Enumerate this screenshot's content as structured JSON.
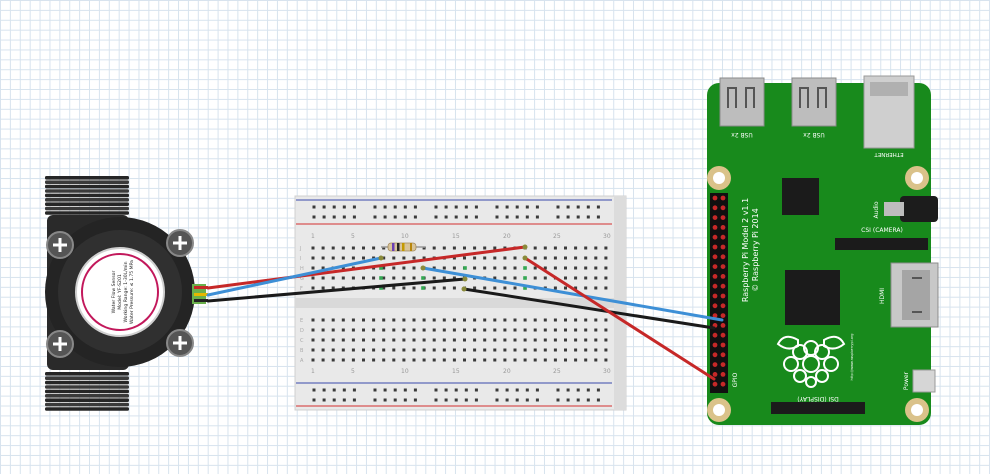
{
  "canvas": {
    "width": 990,
    "height": 474,
    "grid": true
  },
  "sensor": {
    "label_lines": [
      "Water Flow Sensor",
      "Model: YF-S201",
      "Working Range: 1-30L/min",
      "Water Pressure: ≤ 1.75 MPa"
    ],
    "body_color": "#2f2f2f",
    "dial_color": "#ffffff",
    "ring_color": "#c2185b",
    "screw_icon": "phillips-screw-icon"
  },
  "breadboard": {
    "rail_positive_color": "#d32f2f",
    "rail_negative_color": "#3949ab",
    "column_numbers": [
      "1",
      "5",
      "10",
      "15",
      "20",
      "25",
      "30"
    ],
    "row_letters_top": [
      "J",
      "I",
      "H",
      "G",
      "F"
    ],
    "row_letters_bottom": [
      "E",
      "D",
      "C",
      "B",
      "A"
    ],
    "resistor_icon": "resistor-icon"
  },
  "pi": {
    "board_color": "#188a1c",
    "title_line1": "Raspberry Pi Model 2 v1.1",
    "title_line2": "© Raspberry Pi 2014",
    "usb1_label": "USB 2x",
    "usb2_label": "USB 2x",
    "ethernet_label": "ETHERNET",
    "audio_label": "Audio",
    "csi_label": "CSI (CAMERA)",
    "hdmi_label": "HDMI",
    "dsi_label": "DSI (DISPLAY)",
    "gpio_label": "GPIO",
    "power_label": "Power",
    "url_label": "http://www.raspberrypi.org",
    "logo_icon": "raspberry-logo-icon"
  },
  "wires": {
    "power_color": "#c62828",
    "signal_color": "#3d8fd6",
    "ground_color": "#1a1a1a"
  }
}
